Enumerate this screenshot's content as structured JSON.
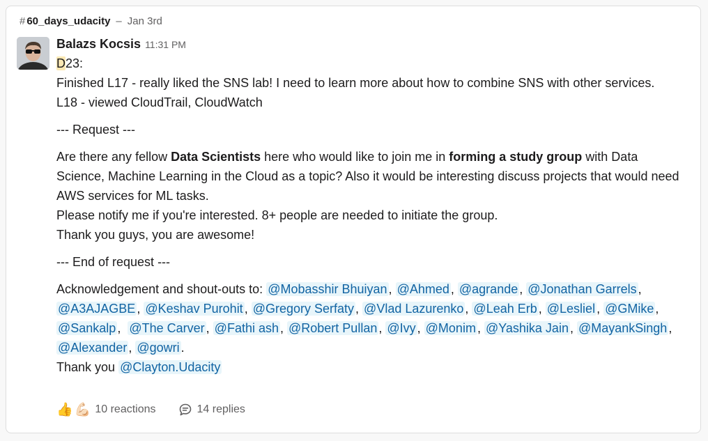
{
  "channel": {
    "hash": "#",
    "name": "60_days_udacity",
    "separator": "–",
    "date": "Jan 3rd"
  },
  "message": {
    "author": "Balazs Kocsis",
    "time": "11:31 PM",
    "day_highlight": "D",
    "day_rest": "23:",
    "line1": "Finished L17 - really liked the SNS lab! I need to learn more about how to combine SNS with other services.",
    "line2": "L18 - viewed CloudTrail, CloudWatch",
    "request_start": "--- Request ---",
    "req_a": "Are there any fellow ",
    "req_b": "Data Scientists",
    "req_c": " here who would like to join me in ",
    "req_d": "forming a study group",
    "req_e": " with Data Science, Machine Learning in the Cloud as a topic? Also it would be interesting discuss projects that would need AWS services for ML tasks.",
    "notify": "Please notify me if you're interested. 8+ people are needed to initiate the group.",
    "thanks": "Thank you guys, you are awesome!",
    "request_end": "--- End of request ---",
    "ack_prefix": "Acknowledgement and shout-outs to: ",
    "mentions": [
      "@Mobasshir Bhuiyan",
      "@Ahmed",
      "@agrande",
      "@Jonathan Garrels",
      "@A3AJAGBE",
      "@Keshav Purohit",
      "@Gregory Serfaty",
      "@Vlad Lazurenko",
      "@Leah Erb",
      "@Lesliel",
      "@GMike",
      "@Sankalp",
      "@The Carver",
      "@Fathi ash",
      "@Robert Pullan",
      "@Ivy",
      "@Monim",
      "@Yashika Jain",
      "@MayankSingh",
      "@Alexander",
      "@gowri"
    ],
    "thank_you_prefix": "Thank you ",
    "thank_you_mention": "@Clayton.Udacity"
  },
  "footer": {
    "emoji1": "👍",
    "emoji2": "💪🏻",
    "reactions_label": "10 reactions",
    "replies_label": "14 replies"
  },
  "icons": {
    "reply": "reply-bubble-icon",
    "avatar": "user-avatar"
  }
}
